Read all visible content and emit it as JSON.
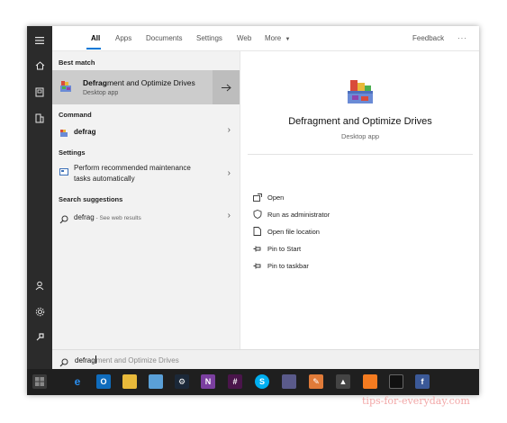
{
  "tabs": [
    {
      "label": "All",
      "active": true
    },
    {
      "label": "Apps"
    },
    {
      "label": "Documents"
    },
    {
      "label": "Settings"
    },
    {
      "label": "Web"
    },
    {
      "label": "More"
    }
  ],
  "header": {
    "feedback": "Feedback",
    "overflow": "···"
  },
  "results": {
    "best_match_heading": "Best match",
    "best_match": {
      "title_bold": "Defrag",
      "title_rest": "ment and Optimize Drives",
      "subtitle": "Desktop app"
    },
    "command_heading": "Command",
    "command": {
      "label": "defrag"
    },
    "settings_heading": "Settings",
    "setting": {
      "line1": "Perform recommended maintenance",
      "line2": "tasks automatically"
    },
    "suggestions_heading": "Search suggestions",
    "suggestion": {
      "term": "defrag",
      "hint": " - See web results"
    }
  },
  "detail": {
    "title": "Defragment and Optimize Drives",
    "subtitle": "Desktop app",
    "actions": [
      {
        "label": "Open",
        "icon": "open-icon"
      },
      {
        "label": "Run as administrator",
        "icon": "shield-icon"
      },
      {
        "label": "Open file location",
        "icon": "file-location-icon"
      },
      {
        "label": "Pin to Start",
        "icon": "pin-icon"
      },
      {
        "label": "Pin to taskbar",
        "icon": "pin-icon"
      }
    ]
  },
  "search": {
    "typed": "defrag",
    "completion": "ment and Optimize Drives"
  },
  "watermark": "tips-for-everyday.com",
  "colors": {
    "accent": "#0078d7",
    "rail": "#2b2b2b",
    "taskbar": "#1f1f1f",
    "selected": "#cccccc"
  }
}
